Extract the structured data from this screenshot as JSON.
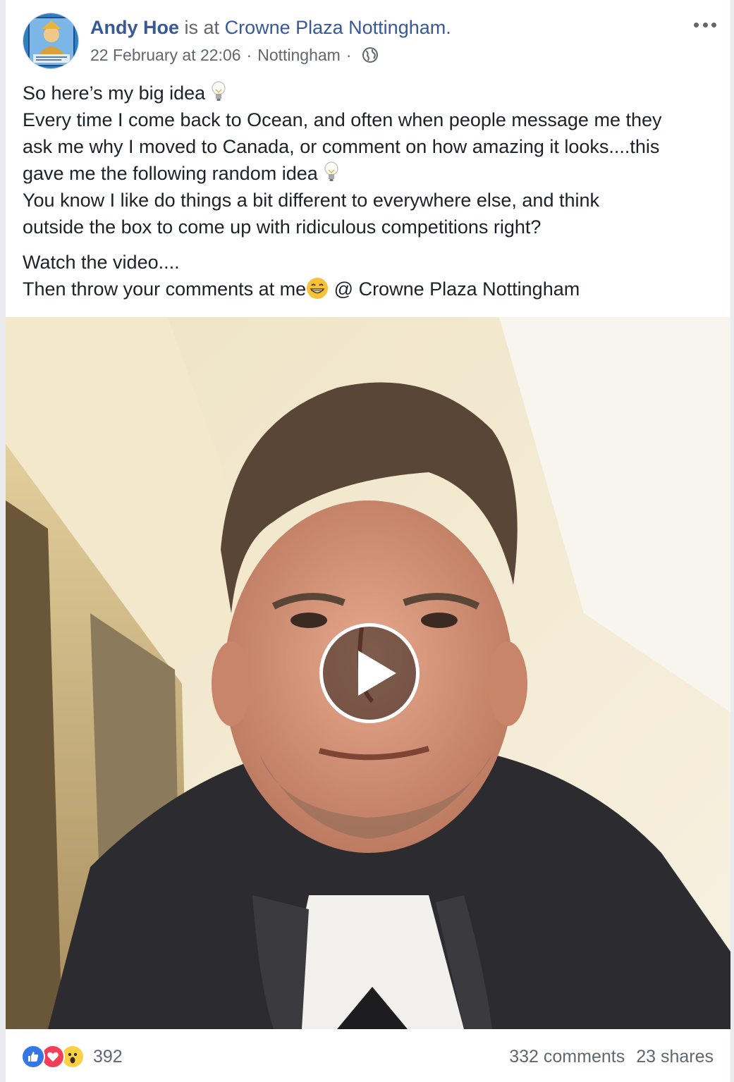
{
  "post": {
    "author": "Andy Hoe",
    "is_at": "is at",
    "place": "Crowne Plaza Nottingham.",
    "date": "22 February at 22:06",
    "location": "Nottingham",
    "separator": "·",
    "privacy_icon": "globe-icon",
    "body": {
      "para1": [
        "So here’s my big idea",
        "Every time I come back to Ocean, and often when people message me they",
        "ask me why I moved to Canada, or comment on how amazing it looks....this",
        "gave me the following random idea",
        "You know I like do things a bit different to everywhere else, and think",
        "outside the box to come up with ridiculous competitions right?"
      ],
      "para2": [
        "Watch the video....",
        "Then throw your comments at me",
        " @ Crowne Plaza Nottingham"
      ]
    },
    "emojis": [
      "lightbulb-icon",
      "grinning-face-icon"
    ]
  },
  "video": {
    "play_icon": "play-icon"
  },
  "footer": {
    "reactions": [
      "like",
      "love",
      "wow"
    ],
    "reaction_count": "392",
    "comments": "332 comments",
    "shares": "23 shares"
  },
  "colors": {
    "link": "#385898",
    "muted": "#616770",
    "like": "#3578e5",
    "love": "#f33e58",
    "wow": "#fcd146"
  }
}
